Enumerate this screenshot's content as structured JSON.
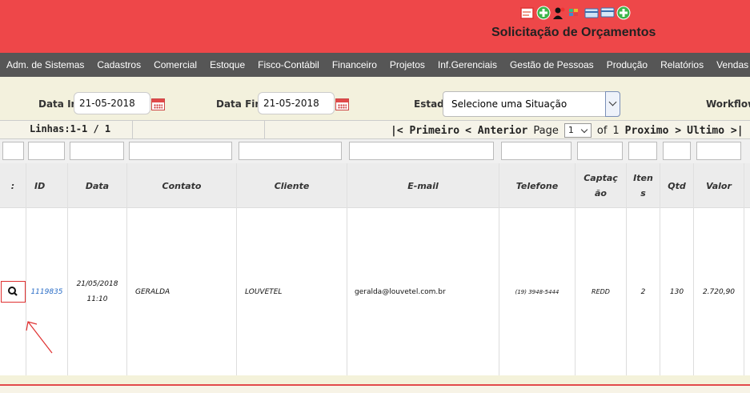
{
  "header": {
    "title": "Solicitação de Orçamentos",
    "icons": [
      "report-icon",
      "add-icon",
      "users-icon",
      "grid-icon",
      "card-icon",
      "card-icon",
      "add-icon"
    ]
  },
  "nav": {
    "items": [
      "Adm. de Sistemas",
      "Cadastros",
      "Comercial",
      "Estoque",
      "Fisco-Contábil",
      "Financeiro",
      "Projetos",
      "Inf.Gerenciais",
      "Gestão de Pessoas",
      "Produção",
      "Relatórios",
      "Vendas"
    ]
  },
  "filters": {
    "data_ini_label": "Data Ini.",
    "data_ini_value": "21-05-2018",
    "data_final_label": "Data Final",
    "data_final_value": "21-05-2018",
    "estado_label": "Estado",
    "estado_value": "Selecione uma Situação",
    "workflow_label": "Workflow"
  },
  "pager": {
    "rows": "Linhas:1-1 / 1",
    "first": "|< Primeiro",
    "prev": "< Anterior",
    "page_label": "Page",
    "page_value": "1",
    "of_label": "of",
    "total_pages": "1",
    "next": "Proximo >",
    "last": "Ultimo >|"
  },
  "table": {
    "headers": [
      ":",
      "ID",
      "Data",
      "Contato",
      "Cliente",
      "E-mail",
      "Telefone",
      "Captaç ão",
      "Iten s",
      "Qtd",
      "Valor"
    ],
    "row": {
      "id": "1119835",
      "data_date": "21/05/2018",
      "data_time": "11:10",
      "contato": "GERALDA",
      "cliente": "LOUVETEL",
      "email": "geralda@louvetel.com.br",
      "telefone": "(19) 3948-5444",
      "captacao": "REDD",
      "itens": "2",
      "qtd": "130",
      "valor": "2.720,90"
    }
  },
  "colors": {
    "header_bg": "#ee4749",
    "nav_bg": "#565656",
    "filter_bg": "#f3f1dd",
    "link": "#2a6dc7",
    "accent_red": "#e03030"
  }
}
